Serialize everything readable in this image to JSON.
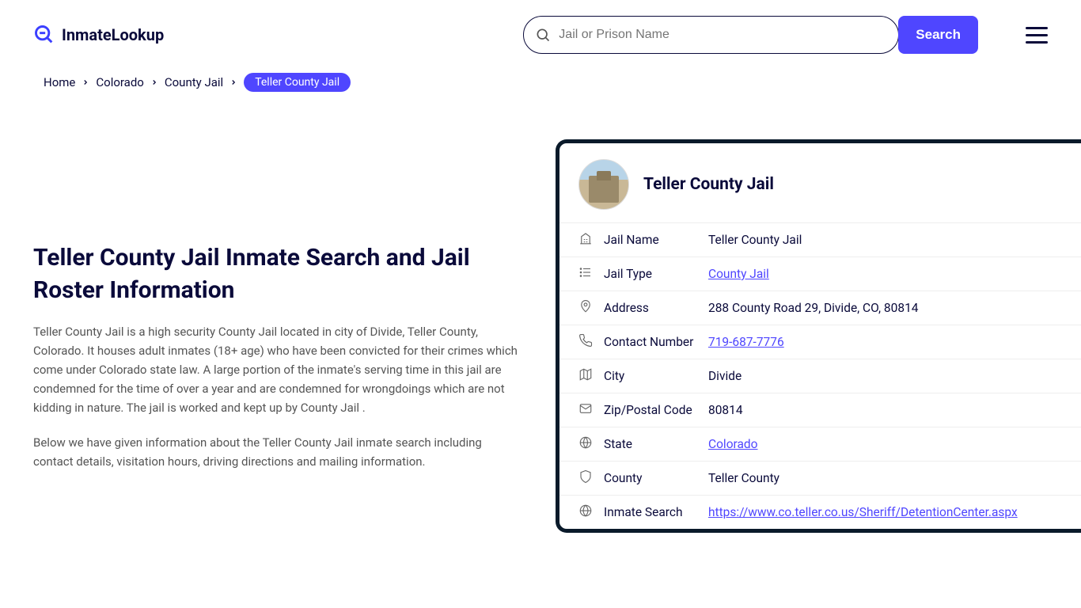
{
  "brand": "InmateLookup",
  "search": {
    "placeholder": "Jail or Prison Name",
    "button": "Search"
  },
  "breadcrumbs": {
    "items": [
      "Home",
      "Colorado",
      "County Jail"
    ],
    "current": "Teller County Jail"
  },
  "page": {
    "title": "Teller County Jail Inmate Search and Jail Roster Information",
    "para1": "Teller County Jail is a high security County Jail located in city of Divide, Teller County, Colorado. It houses adult inmates (18+ age) who have been convicted for their crimes which come under Colorado state law. A large portion of the inmate's serving time in this jail are condemned for the time of over a year and are condemned for wrongdoings which are not kidding in nature. The jail is worked and kept up by County Jail .",
    "para2": "Below we have given information about the Teller County Jail inmate search including contact details, visitation hours, driving directions and mailing information."
  },
  "card": {
    "title": "Teller County Jail",
    "rows": [
      {
        "icon": "building",
        "label": "Jail Name",
        "value": "Teller County Jail",
        "link": false
      },
      {
        "icon": "list",
        "label": "Jail Type",
        "value": "County Jail",
        "link": true
      },
      {
        "icon": "pin",
        "label": "Address",
        "value": "288 County Road 29, Divide, CO, 80814",
        "link": false
      },
      {
        "icon": "phone",
        "label": "Contact Number",
        "value": "719-687-7776",
        "link": true
      },
      {
        "icon": "map",
        "label": "City",
        "value": "Divide",
        "link": false
      },
      {
        "icon": "mail",
        "label": "Zip/Postal Code",
        "value": "80814",
        "link": false
      },
      {
        "icon": "globe",
        "label": "State",
        "value": "Colorado",
        "link": true
      },
      {
        "icon": "shield",
        "label": "County",
        "value": "Teller County",
        "link": false
      },
      {
        "icon": "web",
        "label": "Inmate Search",
        "value": "https://www.co.teller.co.us/Sheriff/DetentionCenter.aspx",
        "link": true
      }
    ]
  }
}
